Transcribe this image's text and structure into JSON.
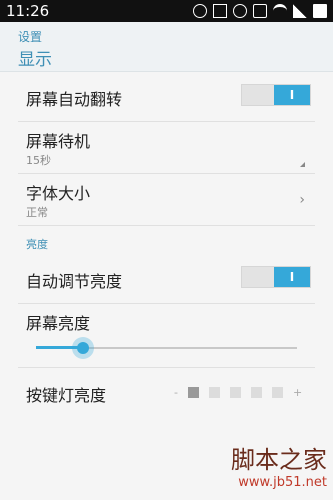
{
  "status_bar": {
    "time": "11:26"
  },
  "header": {
    "crumb": "设置",
    "title": "显示"
  },
  "rows": {
    "auto_rotate": {
      "label": "屏幕自动翻转",
      "toggle_text": "I"
    },
    "screen_timeout": {
      "label": "屏幕待机",
      "value": "15秒"
    },
    "font_size": {
      "label": "字体大小",
      "value": "正常"
    },
    "auto_brightness": {
      "label": "自动调节亮度",
      "toggle_text": "I"
    },
    "brightness": {
      "label": "屏幕亮度",
      "level": 0.18
    },
    "key_light": {
      "label": "按键灯亮度",
      "minus": "-",
      "plus": "+",
      "level": 1,
      "steps": 5
    }
  },
  "section": {
    "brightness_title": "亮度"
  },
  "watermark": {
    "main": "脚本之家",
    "url": "www.jb51.net"
  },
  "colors": {
    "accent": "#35a8d9",
    "header_text": "#3e8fb5",
    "watermark_main": "#6a2c1c",
    "watermark_url": "#c03a2a"
  },
  "icons": [
    "message-icon",
    "grid-icon",
    "alarm-icon",
    "phone-icon",
    "wifi-icon",
    "signal-icon",
    "battery-icon",
    "chevron-right-icon",
    "dropdown-corner-icon"
  ]
}
